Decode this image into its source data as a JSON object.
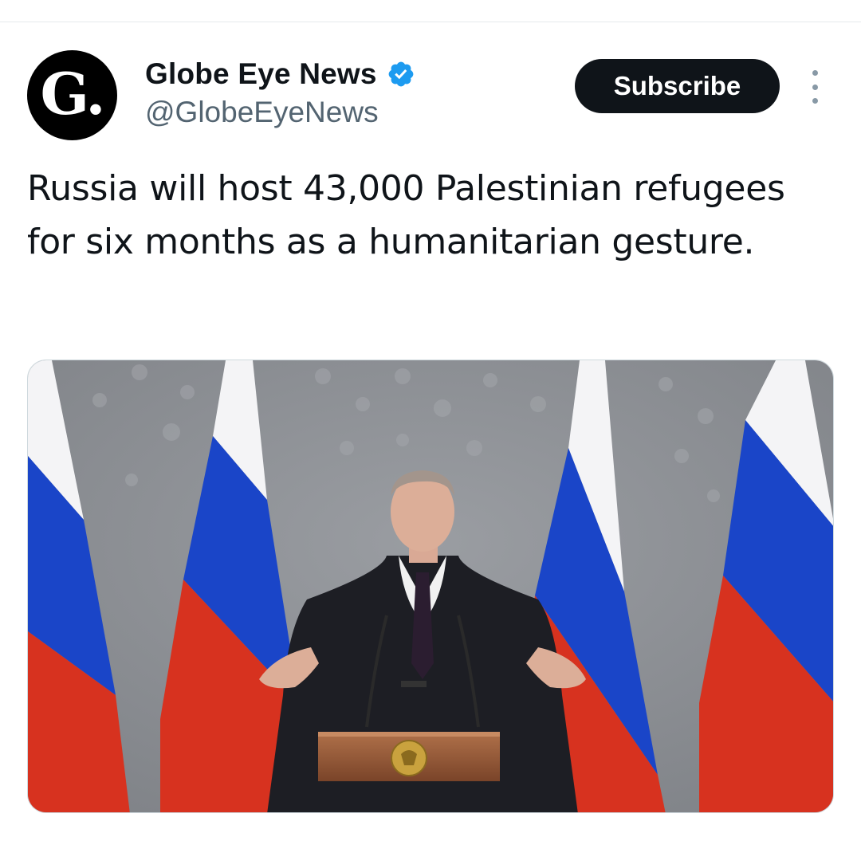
{
  "tweet": {
    "author": {
      "avatar_text": "G.",
      "display_name": "Globe Eye News",
      "handle": "@GlobeEyeNews",
      "verified": true
    },
    "subscribe_label": "Subscribe",
    "text": "Russia will host 43,000 Palestinian refugees for six months as a humanitarian gesture.",
    "media": {
      "description": "Photo of a man at a lectern with microphones in front of four Russian flags",
      "icon": "photo"
    }
  },
  "colors": {
    "text_primary": "#0f1419",
    "text_secondary": "#536471",
    "verified_blue": "#1d9bf0",
    "button_bg": "#0f1419",
    "button_text": "#ffffff",
    "flag_white": "#f4f4f6",
    "flag_blue": "#1a45c8",
    "flag_red": "#d7321f",
    "backdrop_gray": "#8e9196"
  }
}
